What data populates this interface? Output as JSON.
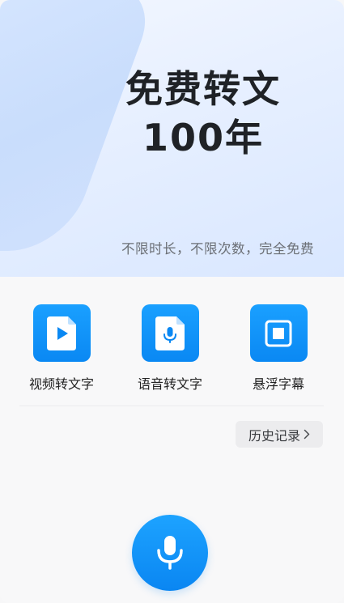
{
  "hero": {
    "title_line1": "免费转文",
    "title_line2": "100年",
    "subtitle": "不限时长，不限次数，完全免费"
  },
  "features": [
    {
      "label": "视频转文字",
      "icon": "video-file-icon"
    },
    {
      "label": "语音转文字",
      "icon": "audio-file-icon"
    },
    {
      "label": "悬浮字幕",
      "icon": "floating-window-icon"
    }
  ],
  "history": {
    "label": "历史记录",
    "icon": "chevron-right-icon"
  },
  "record": {
    "icon": "microphone-icon"
  },
  "colors": {
    "accent": "#0a88f3",
    "hero_bg": "#e6efff",
    "page_bg": "#f8f8f9"
  }
}
